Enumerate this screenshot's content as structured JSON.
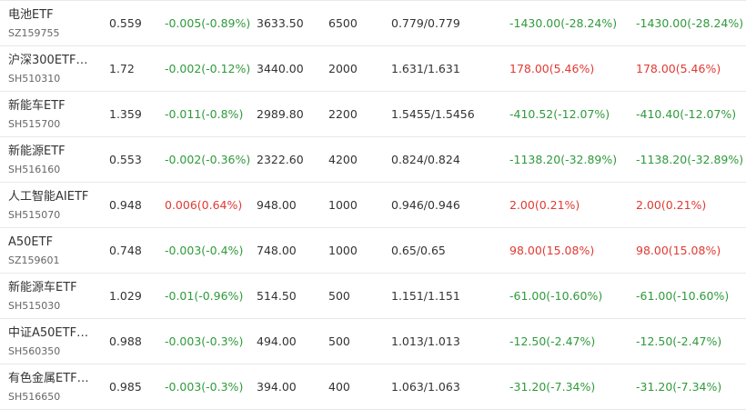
{
  "colors": {
    "up": "#e03a33",
    "down": "#2f9a3c"
  },
  "rows": [
    {
      "name": "电池ETF",
      "code": "SZ159755",
      "price": "0.559",
      "change": "-0.005(-0.89%)",
      "change_dir": "down",
      "value": "3633.50",
      "qty": "6500",
      "cost": "0.779/0.779",
      "pnl": "-1430.00(-28.24%)",
      "pnl_dir": "down",
      "pnl2": "-1430.00(-28.24%)",
      "pnl2_dir": "down"
    },
    {
      "name": "沪深300ETF…",
      "code": "SH510310",
      "price": "1.72",
      "change": "-0.002(-0.12%)",
      "change_dir": "down",
      "value": "3440.00",
      "qty": "2000",
      "cost": "1.631/1.631",
      "pnl": "178.00(5.46%)",
      "pnl_dir": "up",
      "pnl2": "178.00(5.46%)",
      "pnl2_dir": "up"
    },
    {
      "name": "新能车ETF",
      "code": "SH515700",
      "price": "1.359",
      "change": "-0.011(-0.8%)",
      "change_dir": "down",
      "value": "2989.80",
      "qty": "2200",
      "cost": "1.5455/1.5456",
      "pnl": "-410.52(-12.07%)",
      "pnl_dir": "down",
      "pnl2": "-410.40(-12.07%)",
      "pnl2_dir": "down"
    },
    {
      "name": "新能源ETF",
      "code": "SH516160",
      "price": "0.553",
      "change": "-0.002(-0.36%)",
      "change_dir": "down",
      "value": "2322.60",
      "qty": "4200",
      "cost": "0.824/0.824",
      "pnl": "-1138.20(-32.89%)",
      "pnl_dir": "down",
      "pnl2": "-1138.20(-32.89%)",
      "pnl2_dir": "down"
    },
    {
      "name": "人工智能AIETF",
      "code": "SH515070",
      "price": "0.948",
      "change": "0.006(0.64%)",
      "change_dir": "up",
      "value": "948.00",
      "qty": "1000",
      "cost": "0.946/0.946",
      "pnl": "2.00(0.21%)",
      "pnl_dir": "up",
      "pnl2": "2.00(0.21%)",
      "pnl2_dir": "up"
    },
    {
      "name": "A50ETF",
      "code": "SZ159601",
      "price": "0.748",
      "change": "-0.003(-0.4%)",
      "change_dir": "down",
      "value": "748.00",
      "qty": "1000",
      "cost": "0.65/0.65",
      "pnl": "98.00(15.08%)",
      "pnl_dir": "up",
      "pnl2": "98.00(15.08%)",
      "pnl2_dir": "up"
    },
    {
      "name": "新能源车ETF",
      "code": "SH515030",
      "price": "1.029",
      "change": "-0.01(-0.96%)",
      "change_dir": "down",
      "value": "514.50",
      "qty": "500",
      "cost": "1.151/1.151",
      "pnl": "-61.00(-10.60%)",
      "pnl_dir": "down",
      "pnl2": "-61.00(-10.60%)",
      "pnl2_dir": "down"
    },
    {
      "name": "中证A50ETF…",
      "code": "SH560350",
      "price": "0.988",
      "change": "-0.003(-0.3%)",
      "change_dir": "down",
      "value": "494.00",
      "qty": "500",
      "cost": "1.013/1.013",
      "pnl": "-12.50(-2.47%)",
      "pnl_dir": "down",
      "pnl2": "-12.50(-2.47%)",
      "pnl2_dir": "down"
    },
    {
      "name": "有色金属ETF…",
      "code": "SH516650",
      "price": "0.985",
      "change": "-0.003(-0.3%)",
      "change_dir": "down",
      "value": "394.00",
      "qty": "400",
      "cost": "1.063/1.063",
      "pnl": "-31.20(-7.34%)",
      "pnl_dir": "down",
      "pnl2": "-31.20(-7.34%)",
      "pnl2_dir": "down"
    }
  ]
}
